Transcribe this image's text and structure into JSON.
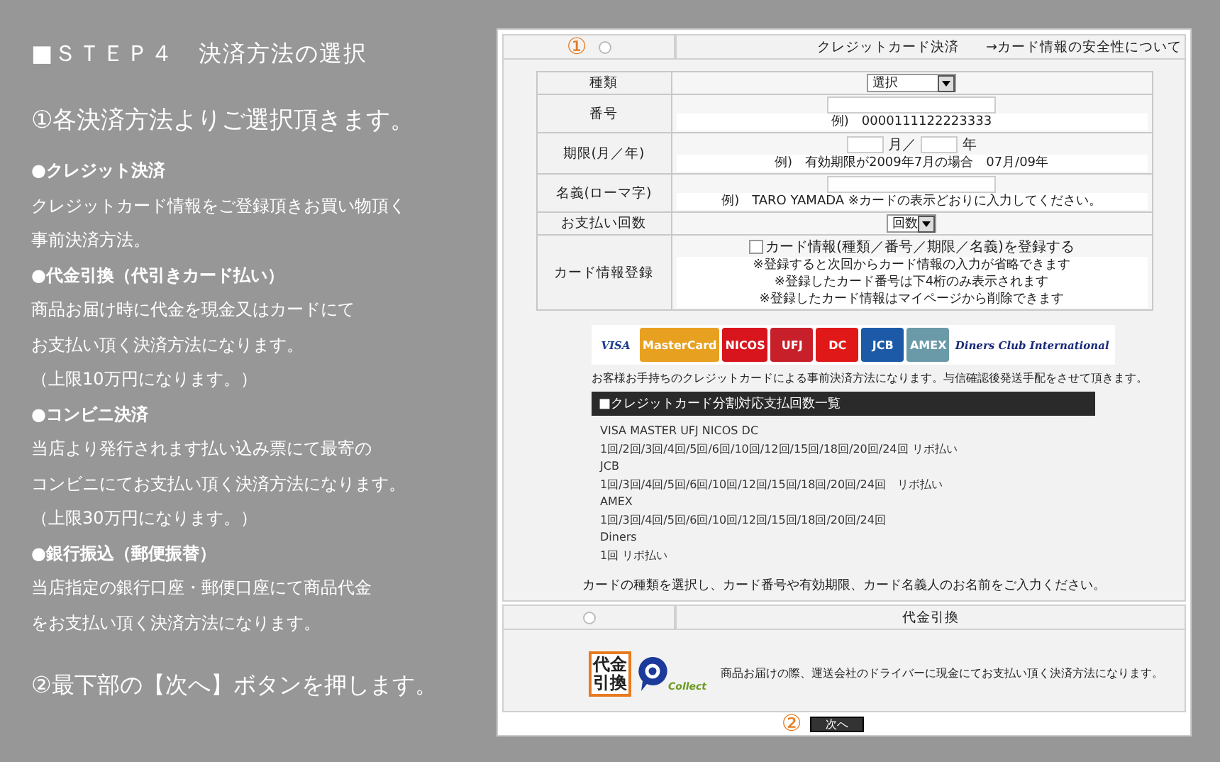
{
  "guide": {
    "title": "■ＳＴＥＰ４　決済方法の選択",
    "step1": "①各決済方法よりご選択頂きます。",
    "lines": [
      {
        "kind": "bullet",
        "text": "●クレジット決済"
      },
      {
        "kind": "body",
        "text": "クレジットカード情報をご登録頂きお買い物頂く"
      },
      {
        "kind": "body",
        "text": "事前決済方法。"
      },
      {
        "kind": "bullet",
        "text": "●代金引換（代引きカード払い）"
      },
      {
        "kind": "body",
        "text": "商品お届け時に代金を現金又はカードにて"
      },
      {
        "kind": "body",
        "text": "お支払い頂く決済方法になります。"
      },
      {
        "kind": "body",
        "text": "（上限10万円になります。）"
      },
      {
        "kind": "bullet",
        "text": "●コンビニ決済"
      },
      {
        "kind": "body",
        "text": "当店より発行されます払い込み票にて最寄の"
      },
      {
        "kind": "body",
        "text": "コンビニにてお支払い頂く決済方法になります。"
      },
      {
        "kind": "body",
        "text": "（上限30万円になります。）"
      },
      {
        "kind": "bullet",
        "text": "●銀行振込（郵便振替）"
      },
      {
        "kind": "body",
        "text": "当店指定の銀行口座・郵便口座にて商品代金"
      },
      {
        "kind": "body",
        "text": "をお支払い頂く決済方法になります。"
      }
    ],
    "step2": "②最下部の【次へ】ボタンを押します。"
  },
  "credit": {
    "marker": "①",
    "title": "クレジットカード決済",
    "link": "→カード情報の安全性について",
    "form": [
      {
        "kind": "select",
        "label": "種類",
        "value": "選択"
      },
      {
        "kind": "text",
        "label": "番号",
        "hint": "例)　0000111122223333"
      },
      {
        "kind": "expiry",
        "label": "期限(月／年)",
        "month_unit": "月／",
        "year_unit": "年",
        "hint": "例)　有効期限が2009年7月の場合　07月/09年"
      },
      {
        "kind": "text",
        "label": "名義(ローマ字)",
        "hint": "例)　TARO YAMADA ※カードの表示どおりに入力してください。"
      },
      {
        "kind": "select",
        "label": "お支払い回数",
        "value": "回数"
      },
      {
        "kind": "checkbox",
        "label": "カード情報登録",
        "checkbox_label": "カード情報(種類／番号／期限／名義)を登録する",
        "checked": false,
        "notes": [
          "※登録すると次回からカード情報の入力が省略できます",
          "※登録したカード番号は下4桁のみ表示されます",
          "※登録したカード情報はマイページから削除できます"
        ]
      }
    ],
    "logos": [
      {
        "label": "VISA",
        "color": "#1a3d8f"
      },
      {
        "label": "MasterCard",
        "color": "#e8a020"
      },
      {
        "label": "NICOS",
        "color": "#d8141c"
      },
      {
        "label": "UFJ",
        "color": "#c8202a"
      },
      {
        "label": "DC",
        "color": "#e01818"
      },
      {
        "label": "JCB",
        "color": "#1c5aa8"
      },
      {
        "label": "AMEX",
        "color": "#6a9aa8"
      },
      {
        "label": "Diners Club International",
        "color": "#1a2a7a"
      }
    ],
    "description": "お客様お手持ちのクレジットカードによる事前決済方法になります。与信確認後発送手配をさせて頂きます。",
    "installments_title": "■クレジットカード分割対応支払回数一覧",
    "installments": [
      "VISA  MASTER  UFJ NICOS DC",
      "1回/2回/3回/4回/5回/6回/10回/12回/15回/18回/20回/24回  リボ払い",
      "JCB",
      "1回/3回/4回/5回/6回/10回/12回/15回/18回/20回/24回　リボ払い",
      "AMEX",
      "1回/3回/4回/5回/6回/10回/12回/15回/18回/20回/24回",
      "Diners",
      "1回  リボ払い"
    ],
    "instruction": "カードの種類を選択し、カード番号や有効期限、カード名義人のお名前をご入力ください。"
  },
  "cod": {
    "title": "代金引換",
    "badge_lines": [
      "代金",
      "引換"
    ],
    "collect_label": "Collect",
    "description": "商品お届けの際、運送会社のドライバーに現金にてお支払い頂く決済方法になります。"
  },
  "footer": {
    "marker": "②",
    "next": "次へ"
  }
}
